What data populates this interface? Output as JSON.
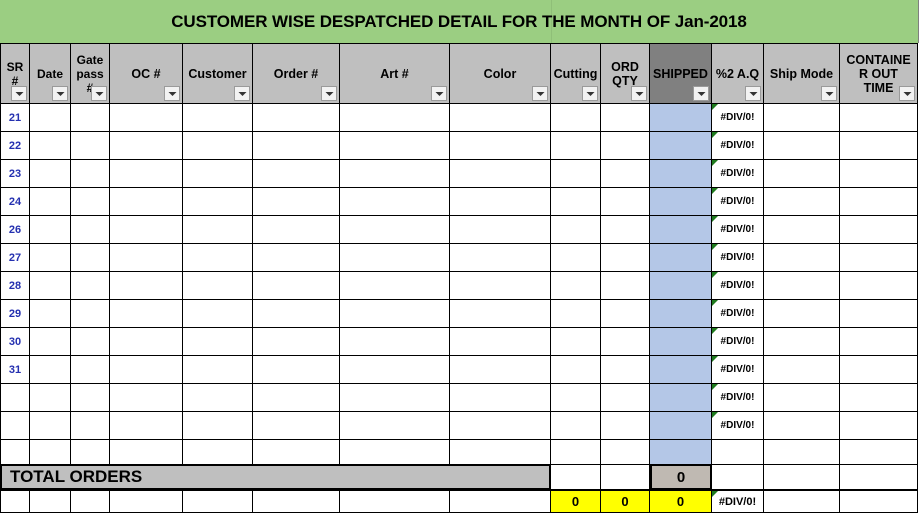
{
  "title": {
    "text": "CUSTOMER WISE DESPATCHED DETAIL FOR THE MONTH OF Jan-2018",
    "background_color": "#9BCE82"
  },
  "colors": {
    "title_green": "#9BCE82",
    "header_gray": "#BFBFBF",
    "shipped_header_gray": "#808080",
    "shipped_column_blue": "#B4C7E7",
    "total_value_gray": "#BFB9B2",
    "sum_yellow": "#FFFF00",
    "sr_number_blue": "#2430B0",
    "error_triangle_green": "#1E7A1E"
  },
  "columns": [
    {
      "key": "sr",
      "label": "SR #",
      "width": 30,
      "filter": true
    },
    {
      "key": "date",
      "label": "Date",
      "width": 41,
      "filter": true
    },
    {
      "key": "gatepass",
      "label": "Gate\npass\n#",
      "width": 39,
      "filter": true
    },
    {
      "key": "oc",
      "label": "OC #",
      "width": 73,
      "filter": true
    },
    {
      "key": "customer",
      "label": "Customer",
      "width": 70,
      "filter": true
    },
    {
      "key": "order",
      "label": "Order #",
      "width": 87,
      "filter": true
    },
    {
      "key": "art",
      "label": "Art #",
      "width": 110,
      "filter": true
    },
    {
      "key": "color",
      "label": "Color",
      "width": 101,
      "filter": true
    },
    {
      "key": "cutting",
      "label": "Cutting",
      "width": 50,
      "filter": true
    },
    {
      "key": "ordqty",
      "label": "ORD\nQTY",
      "width": 49,
      "filter": true
    },
    {
      "key": "shipped",
      "label": "SHIPPED",
      "width": 62,
      "filter": true
    },
    {
      "key": "aq",
      "label": "%2 A.Q",
      "width": 52,
      "filter": true
    },
    {
      "key": "shipmode",
      "label": "Ship Mode",
      "width": 76,
      "filter": true
    },
    {
      "key": "container",
      "label": "CONTAINE\nR OUT\nTIME",
      "width": 78,
      "filter": true
    }
  ],
  "rows": [
    {
      "sr": "21",
      "aq": "#DIV/0!",
      "aq_error": true
    },
    {
      "sr": "22",
      "aq": "#DIV/0!",
      "aq_error": true
    },
    {
      "sr": "23",
      "aq": "#DIV/0!",
      "aq_error": true
    },
    {
      "sr": "24",
      "aq": "#DIV/0!",
      "aq_error": true
    },
    {
      "sr": "26",
      "aq": "#DIV/0!",
      "aq_error": true
    },
    {
      "sr": "27",
      "aq": "#DIV/0!",
      "aq_error": true
    },
    {
      "sr": "28",
      "aq": "#DIV/0!",
      "aq_error": true
    },
    {
      "sr": "29",
      "aq": "#DIV/0!",
      "aq_error": true
    },
    {
      "sr": "30",
      "aq": "#DIV/0!",
      "aq_error": true
    },
    {
      "sr": "31",
      "aq": "#DIV/0!",
      "aq_error": true
    },
    {
      "sr": "",
      "aq": "#DIV/0!",
      "aq_error": true
    },
    {
      "sr": "",
      "aq": "#DIV/0!",
      "aq_error": true
    },
    {
      "sr": "",
      "aq": "",
      "aq_error": false
    }
  ],
  "total_row": {
    "label": "TOTAL ORDERS",
    "shipped_value": "0"
  },
  "sum_row": {
    "cutting": "0",
    "ord_qty": "0",
    "shipped": "0",
    "aq": "#DIV/0!",
    "aq_error": true
  },
  "icons": {
    "filter_dropdown": "chevron-down-icon"
  }
}
